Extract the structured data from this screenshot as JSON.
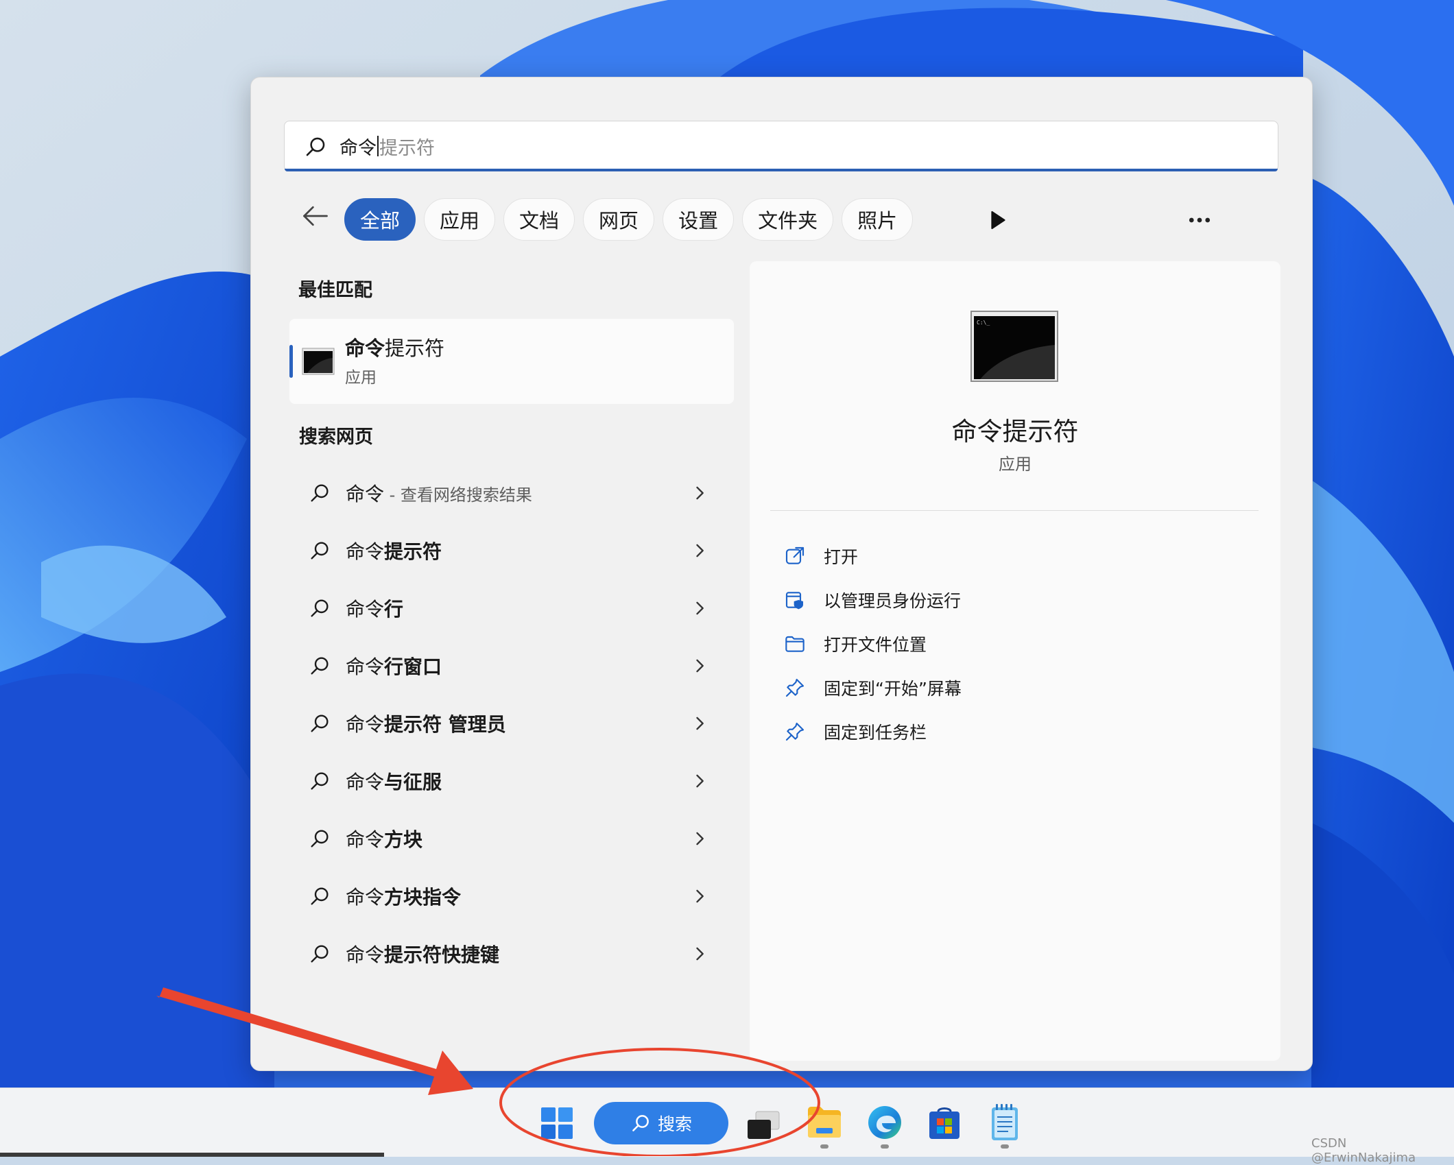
{
  "search": {
    "typed": "命令",
    "suggestion": "提示符"
  },
  "filters": {
    "chips": [
      "全部",
      "应用",
      "文档",
      "网页",
      "设置",
      "文件夹",
      "照片"
    ],
    "active_index": 0
  },
  "best_match": {
    "heading": "最佳匹配",
    "name_bold": "命令",
    "name_rest": "提示符",
    "type": "应用"
  },
  "web_search": {
    "heading": "搜索网页",
    "items": [
      {
        "keyword": "命令",
        "rest": "",
        "hint": " - 查看网络搜索结果"
      },
      {
        "keyword": "命令",
        "rest": "提示符",
        "hint": ""
      },
      {
        "keyword": "命令",
        "rest": "行",
        "hint": ""
      },
      {
        "keyword": "命令",
        "rest": "行窗口",
        "hint": ""
      },
      {
        "keyword": "命令",
        "rest": "提示符 管理员",
        "hint": ""
      },
      {
        "keyword": "命令",
        "rest": "与征服",
        "hint": ""
      },
      {
        "keyword": "命令",
        "rest": "方块",
        "hint": ""
      },
      {
        "keyword": "命令",
        "rest": "方块指令",
        "hint": ""
      },
      {
        "keyword": "命令",
        "rest": "提示符快捷键",
        "hint": ""
      }
    ]
  },
  "preview": {
    "name": "命令提示符",
    "type": "应用",
    "actions": [
      {
        "label": "打开",
        "icon": "open-external-icon"
      },
      {
        "label": "以管理员身份运行",
        "icon": "admin-shield-icon"
      },
      {
        "label": "打开文件位置",
        "icon": "folder-icon"
      },
      {
        "label": "固定到“开始”屏幕",
        "icon": "pin-icon"
      },
      {
        "label": "固定到任务栏",
        "icon": "pin-icon"
      }
    ]
  },
  "taskbar": {
    "search_label": "搜索",
    "watermark": "CSDN @ErwinNakajima"
  },
  "colors": {
    "accent": "#2a62be",
    "taskbar_search": "#2f7fe6",
    "annotation": "#e8452f"
  }
}
